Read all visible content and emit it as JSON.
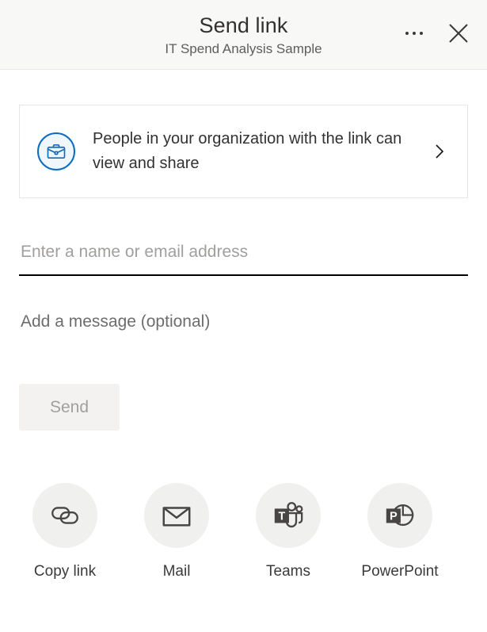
{
  "header": {
    "title": "Send link",
    "subtitle": "IT Spend Analysis Sample",
    "more_label": "More options",
    "close_label": "Close"
  },
  "link_settings": {
    "icon": "briefcase-icon",
    "text": "People in your organization with the link can view and share",
    "chevron": "chevron-right-icon",
    "accent_color": "#0f6cbd",
    "accent_fill": "#eff6fc"
  },
  "recipients": {
    "placeholder": "Enter a name or email address",
    "value": ""
  },
  "message": {
    "placeholder": "Add a message (optional)",
    "value": ""
  },
  "send": {
    "label": "Send",
    "disabled": true
  },
  "share_targets": [
    {
      "label": "Copy link",
      "icon": "link-icon"
    },
    {
      "label": "Mail",
      "icon": "mail-icon"
    },
    {
      "label": "Teams",
      "icon": "teams-icon"
    },
    {
      "label": "PowerPoint",
      "icon": "powerpoint-icon"
    }
  ]
}
